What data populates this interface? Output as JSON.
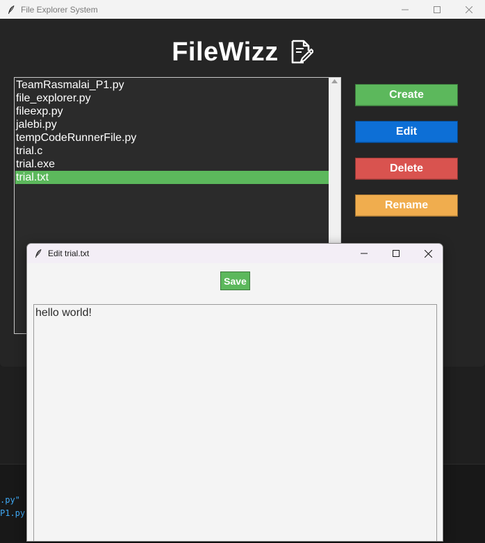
{
  "main_window": {
    "title": "File Explorer System",
    "app_title": "FileWizz",
    "files": [
      "TeamRasmalai_P1.py",
      "file_explorer.py",
      "fileexp.py",
      "jalebi.py",
      "tempCodeRunnerFile.py",
      "trial.c",
      "trial.exe",
      "trial.txt"
    ],
    "selected_file": "trial.txt",
    "buttons": {
      "create": "Create",
      "edit": "Edit",
      "delete": "Delete",
      "rename": "Rename"
    },
    "button_colors": {
      "create": "#5cb85c",
      "edit": "#0d6fd6",
      "delete": "#d9534f",
      "rename": "#f0ad4e"
    }
  },
  "edit_window": {
    "title": "Edit trial.txt",
    "save_label": "Save",
    "content": "hello world!"
  },
  "background_terminal": {
    "lines": [
      ".py\"",
      "P1.py\""
    ]
  },
  "icons": {
    "app": "feather-icon",
    "header": "edit-document-icon",
    "minimize": "minimize-icon",
    "maximize": "maximize-icon",
    "close": "close-icon",
    "scroll_up": "scroll-up-arrow-icon"
  }
}
